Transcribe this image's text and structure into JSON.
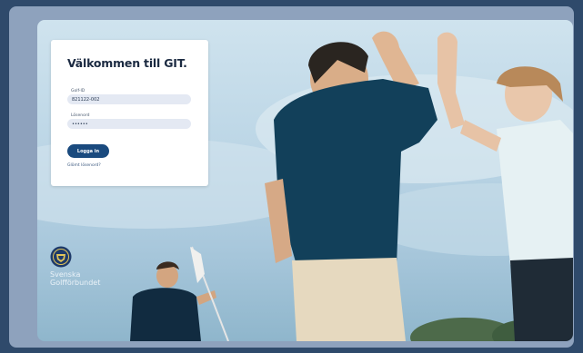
{
  "login": {
    "title": "Välkommen till GIT.",
    "golf_id_label": "Golf-ID",
    "golf_id_value": "821122-002",
    "password_label": "Lösenord",
    "password_value": "••••••",
    "login_button": "Logga in",
    "forgot_link": "Glömt lösenord?"
  },
  "brand": {
    "line1": "Svenska",
    "line2": "Golfförbundet"
  },
  "colors": {
    "page_bg": "#2f4a6b",
    "frame": "#8ea2bd",
    "button": "#1a4a7e",
    "title": "#1b2a41"
  }
}
